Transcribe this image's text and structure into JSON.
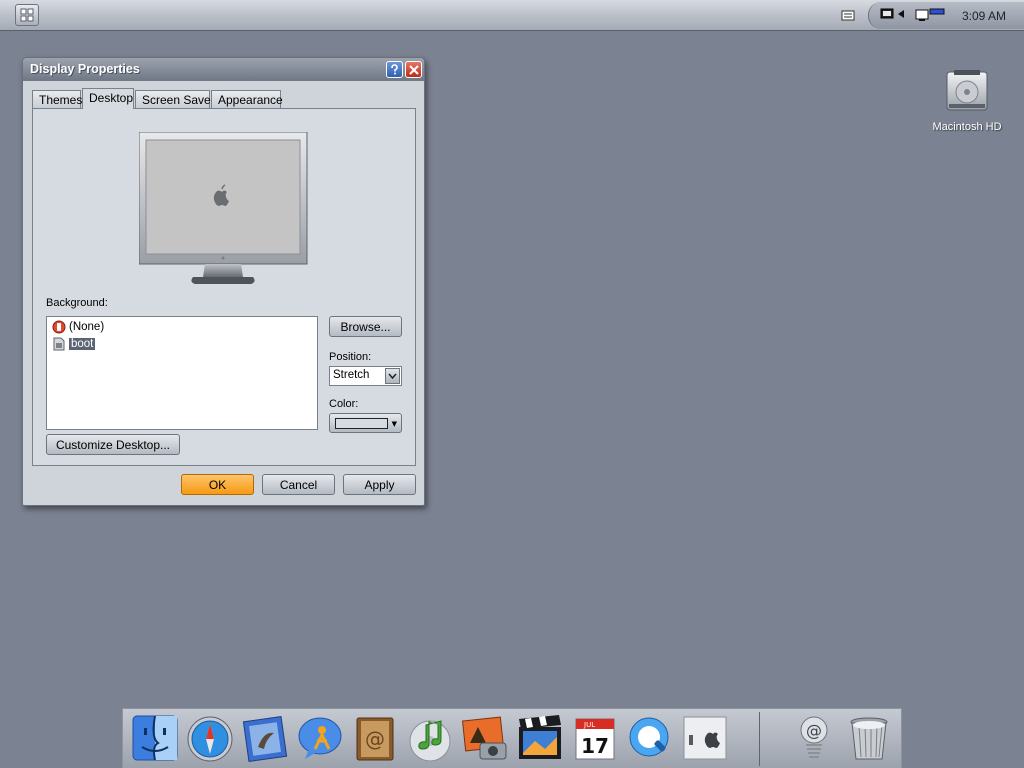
{
  "menubar": {
    "start_icon": "grid-icon",
    "tray_icons": [
      "keyboard-icon",
      "display-icon",
      "volume-icon",
      "network-icon"
    ],
    "clock": "3:09 AM"
  },
  "desktop": {
    "icons": [
      {
        "label": "Macintosh HD",
        "icon": "hard-drive-icon"
      }
    ]
  },
  "window": {
    "title": "Display Properties",
    "tabs": [
      "Themes",
      "Desktop",
      "Screen Saver",
      "Appearance"
    ],
    "active_tab": "Desktop",
    "background_label": "Background:",
    "background_items": [
      {
        "label": "(None)",
        "icon": "none-icon",
        "selected": false
      },
      {
        "label": "boot",
        "icon": "image-file-icon",
        "selected": true
      }
    ],
    "browse_label": "Browse...",
    "position_label": "Position:",
    "position_value": "Stretch",
    "color_label": "Color:",
    "color_value": "#d6dbe1",
    "customize_label": "Customize Desktop...",
    "ok_label": "OK",
    "cancel_label": "Cancel",
    "apply_label": "Apply"
  },
  "dock": {
    "items": [
      "finder-icon",
      "safari-icon",
      "mail-icon",
      "ichat-icon",
      "address-book-icon",
      "itunes-icon",
      "iphoto-icon",
      "imovie-icon",
      "ical-icon",
      "quicktime-icon",
      "system-preferences-icon",
      "internet-connect-icon",
      "trash-icon"
    ],
    "ical_month": "JUL",
    "ical_day": "17"
  },
  "colors": {
    "desktop": "#7b8291",
    "ok_button": "#f59a12",
    "selection": "#5c6473"
  }
}
